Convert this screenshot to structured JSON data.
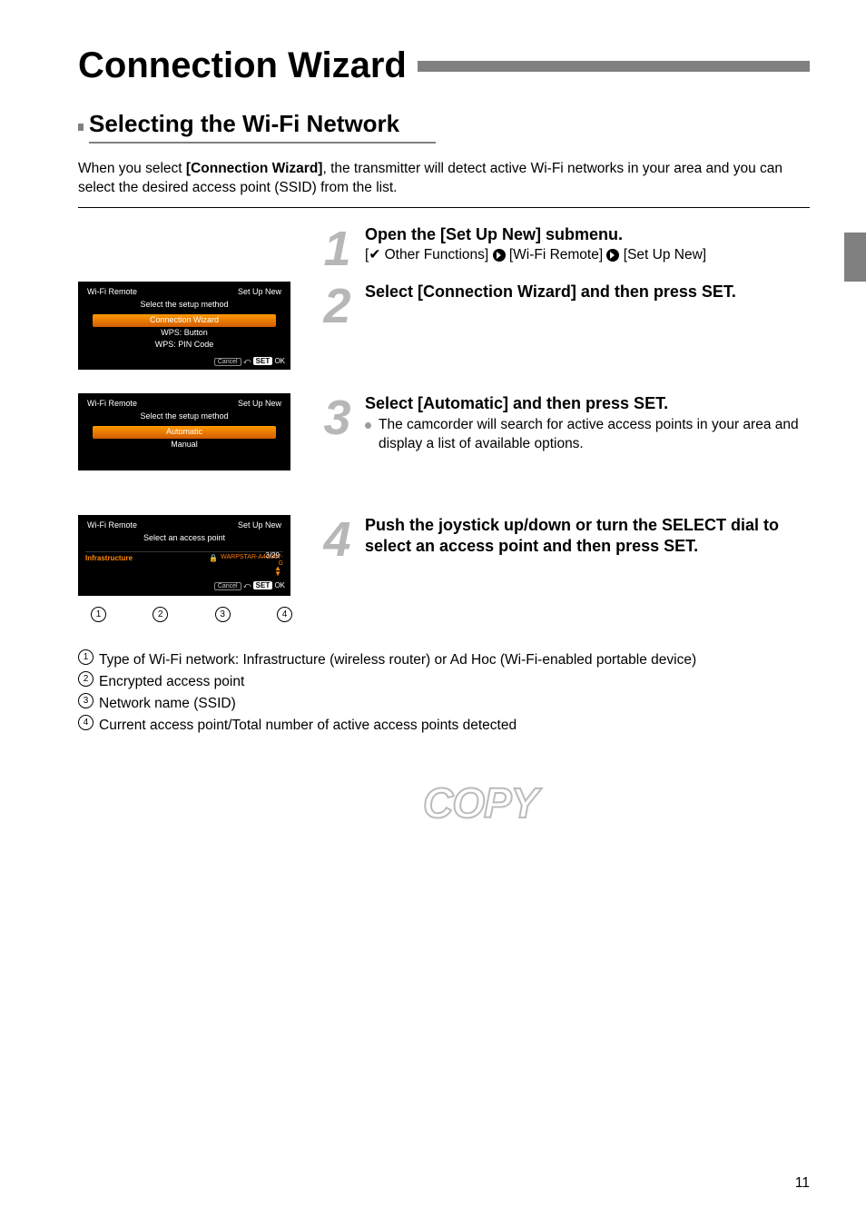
{
  "meta": {
    "page_number": "11",
    "watermark": "COPY"
  },
  "title": "Connection Wizard",
  "section": "Selecting the Wi-Fi Network",
  "intro": {
    "prefix": "When you select ",
    "bold": "[Connection Wizard]",
    "suffix": ", the transmitter will detect active Wi-Fi networks in your area and you can select the desired access point (SSID) from the list."
  },
  "steps": {
    "s1": {
      "num": "1",
      "title": "Open the [Set Up New] submenu.",
      "path_a": "[",
      "path_b": " Other Functions] ",
      "path_c": " [Wi-Fi Remote] ",
      "path_d": " [Set Up New]"
    },
    "s2": {
      "num": "2",
      "title": "Select [Connection Wizard] and then press SET."
    },
    "s3": {
      "num": "3",
      "title": "Select [Automatic] and then press SET.",
      "bullet": "The camcorder will search for active access points in your area and display a list of available options."
    },
    "s4": {
      "num": "4",
      "title": "Push the joystick up/down or turn the SELECT dial to select an access point and then press SET."
    }
  },
  "shots": {
    "a": {
      "hdr_l": "Wi-Fi Remote",
      "hdr_r": "Set Up New",
      "sub": "Select the setup method",
      "o1": "Connection Wizard",
      "o2": "WPS: Button",
      "o3": "WPS: PIN Code",
      "cancel": "Cancel",
      "back": "⤺",
      "set": "SET",
      "ok": "OK"
    },
    "b": {
      "hdr_l": "Wi-Fi Remote",
      "hdr_r": "Set Up New",
      "sub": "Select the setup method",
      "o1": "Automatic",
      "o2": "Manual"
    },
    "c": {
      "hdr_l": "Wi-Fi Remote",
      "hdr_r": "Set Up New",
      "sub": "Select an access point",
      "count": "3/29",
      "col1": "Infrastructure",
      "lock": "🔒",
      "ssid": "WARPSTAR-A4C867-G",
      "cancel": "Cancel",
      "set": "SET",
      "ok": "OK"
    }
  },
  "callouts": {
    "c1": "1",
    "c2": "2",
    "c3": "3",
    "c4": "4"
  },
  "legend": {
    "l1": "Type of Wi-Fi network: Infrastructure (wireless router) or Ad Hoc (Wi-Fi-enabled portable device)",
    "l2": "Encrypted access point",
    "l3": "Network name (SSID)",
    "l4": "Current access point/Total number of active access points detected"
  }
}
